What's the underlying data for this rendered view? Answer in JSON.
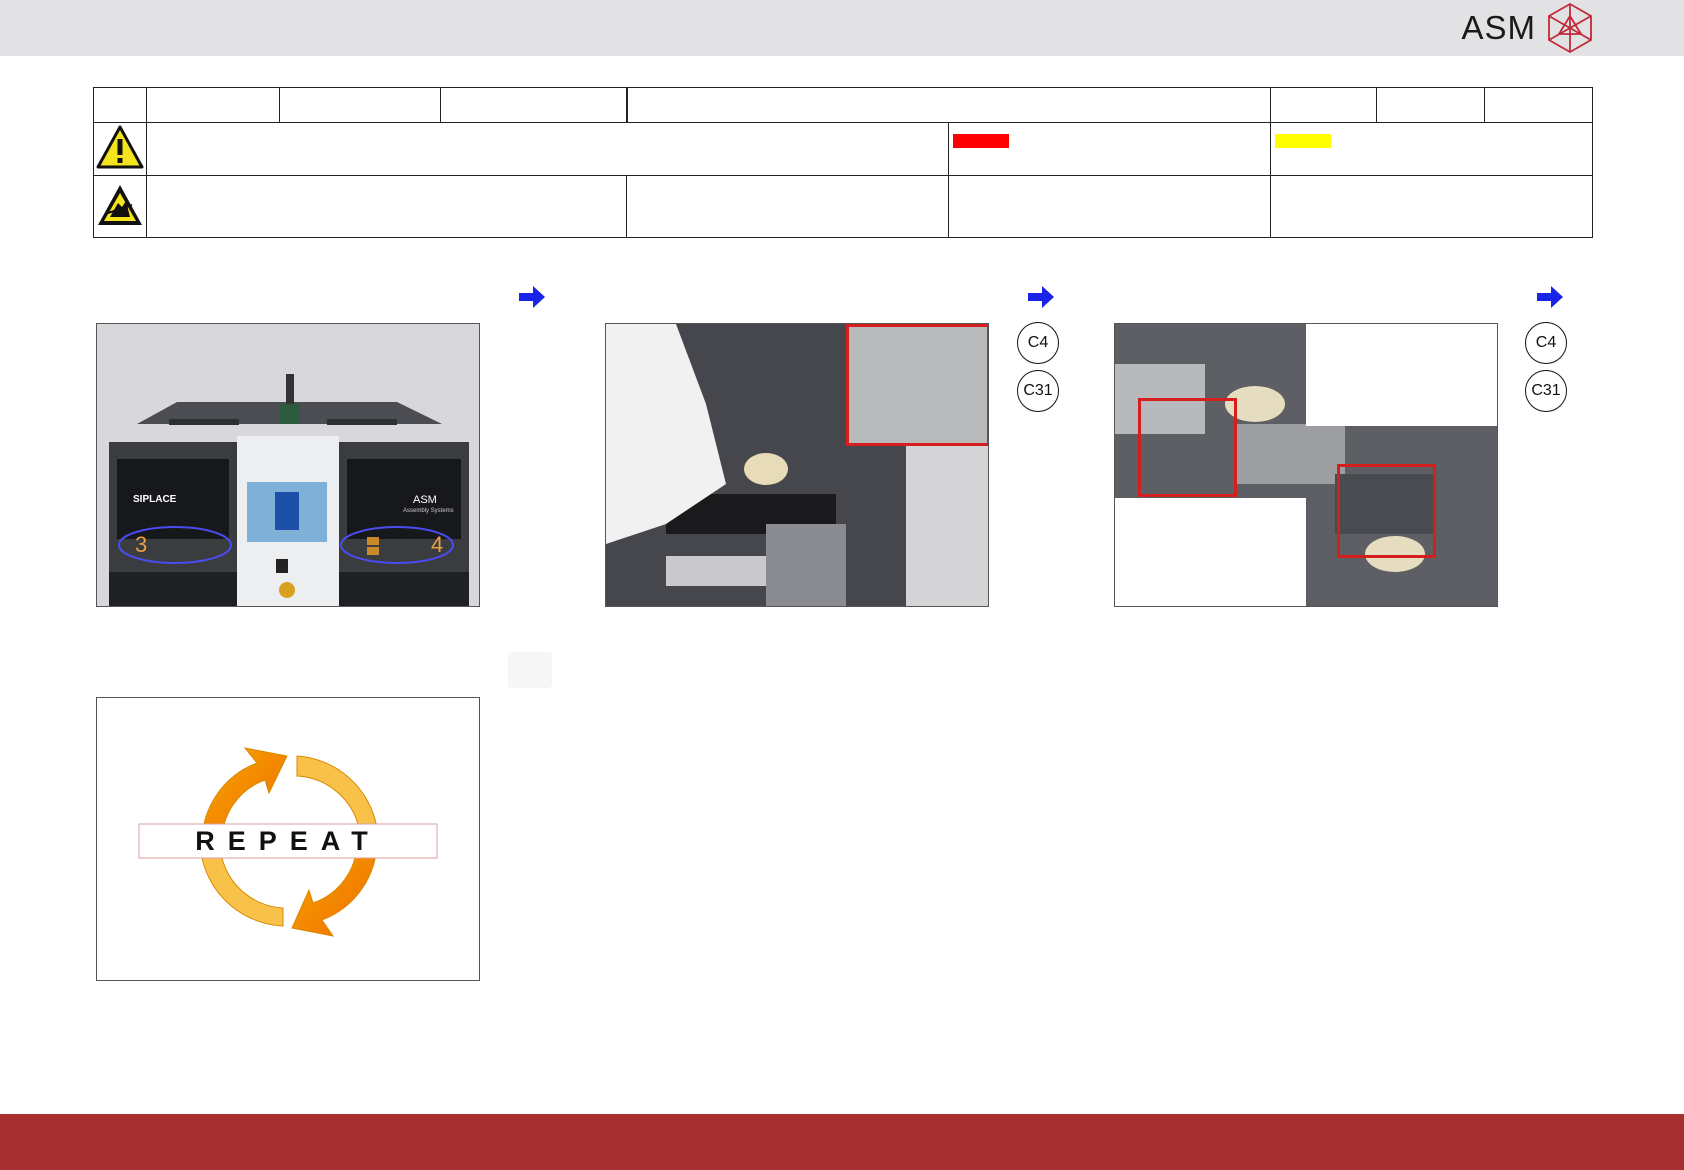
{
  "brand": {
    "name": "ASM",
    "colors": {
      "top_bar": "#e2e2e4",
      "bottom_bar": "#a72f2f",
      "logo_red": "#c22a3a"
    }
  },
  "header_table": {
    "warning_icon": "warning-triangle-icon",
    "esd_icon": "esd-warning-icon",
    "red_swatch": "#ff0000",
    "yellow_swatch": "#ffff00"
  },
  "steps": [
    {
      "arrow_icon": "blue-arrow-right-icon",
      "image": "machine-front-photo",
      "labels": [
        "3",
        "4"
      ],
      "tags": []
    },
    {
      "arrow_icon": "blue-arrow-right-icon",
      "image": "gantry-hand-photo",
      "tags": [
        "C4",
        "C31"
      ]
    },
    {
      "arrow_icon": "blue-arrow-right-icon",
      "image": "gantry-cleaning-photo",
      "tags": [
        "C4",
        "C31"
      ]
    }
  ],
  "repeat": {
    "label": "REPEAT",
    "icon": "repeat-cycle-icon"
  },
  "machine_photo": {
    "brand_left": "SIPLACE",
    "brand_right": "ASM",
    "brand_right_sub": "Assembly Systems",
    "left_number": "3",
    "right_number": "4"
  }
}
